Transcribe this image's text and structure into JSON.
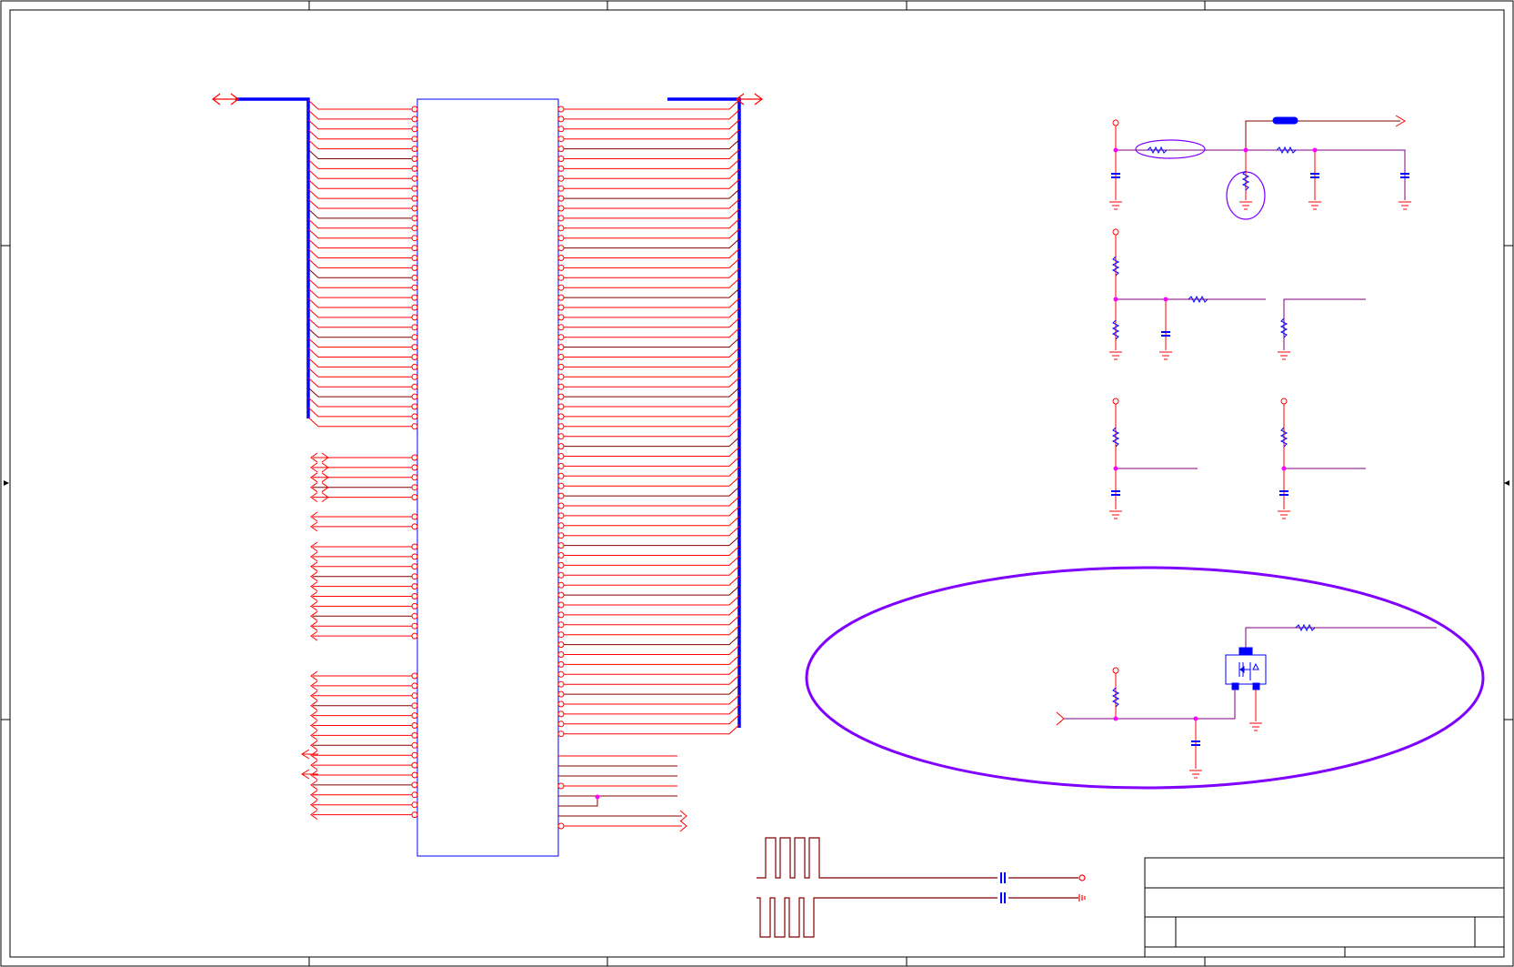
{
  "sheet": {
    "title": "",
    "colors": {
      "frame": "#000000",
      "bus": "#0000ff",
      "wire_red": "#ff0000",
      "wire_dark": "#800000",
      "wire_purple": "#800080",
      "junction": "#ff00ff",
      "part": "#0000ff",
      "highlight": "#7f00ff"
    }
  },
  "connector": {
    "left_bus_pins": 33,
    "right_bus_pins": 64,
    "left_single_groups": [
      5,
      2,
      10,
      15
    ],
    "right_extra_wires": 8
  },
  "title_block": {
    "fields": []
  }
}
